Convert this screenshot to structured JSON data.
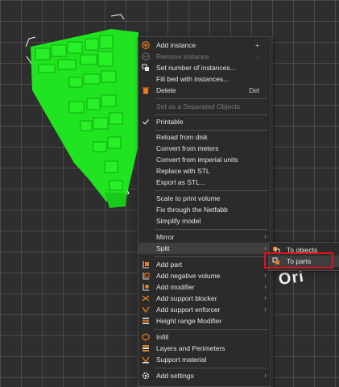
{
  "colors": {
    "model": "#1fe41f",
    "menu_bg": "#2b2b2b",
    "accent": "#e8801c",
    "callout": "#e0101a"
  },
  "bed_text": "Ori",
  "context_menu": {
    "items": [
      {
        "label": "Add instance",
        "shortcut": "+",
        "icon": "plus-circle-icon",
        "disabled": false
      },
      {
        "label": "Remove instance",
        "shortcut": "-",
        "icon": "minus-circle-icon",
        "disabled": true
      },
      {
        "label": "Set number of instances...",
        "icon": "instances-icon",
        "disabled": false
      },
      {
        "label": "Fill bed with instances...",
        "icon": "",
        "disabled": false
      },
      {
        "label": "Delete",
        "shortcut": "Del",
        "icon": "trash-icon",
        "disabled": false
      },
      {
        "label": "Set as a Separated Objects",
        "icon": "",
        "disabled": true
      },
      {
        "label": "Printable",
        "icon": "check-icon",
        "disabled": false
      },
      {
        "label": "Reload from disk",
        "icon": "",
        "disabled": false
      },
      {
        "label": "Convert from meters",
        "icon": "",
        "disabled": false
      },
      {
        "label": "Convert from imperial units",
        "icon": "",
        "disabled": false
      },
      {
        "label": "Replace with STL",
        "icon": "",
        "disabled": false
      },
      {
        "label": "Export as STL...",
        "icon": "",
        "disabled": false
      },
      {
        "label": "Scale to print volume",
        "icon": "",
        "disabled": false
      },
      {
        "label": "Fix through the Netfabb",
        "icon": "",
        "disabled": false
      },
      {
        "label": "Simplify model",
        "icon": "",
        "disabled": false
      },
      {
        "label": "Mirror",
        "icon": "",
        "submenu": true
      },
      {
        "label": "Split",
        "icon": "",
        "submenu": true,
        "active": true
      },
      {
        "label": "Add part",
        "icon": "add-part-icon",
        "submenu": true
      },
      {
        "label": "Add negative volume",
        "icon": "negative-volume-icon",
        "submenu": true
      },
      {
        "label": "Add modifier",
        "icon": "modifier-icon",
        "submenu": true
      },
      {
        "label": "Add support blocker",
        "icon": "support-blocker-icon",
        "submenu": true
      },
      {
        "label": "Add support enforcer",
        "icon": "support-enforcer-icon",
        "submenu": true
      },
      {
        "label": "Height range Modifier",
        "icon": "height-range-icon"
      },
      {
        "label": "Infill",
        "icon": "infill-icon"
      },
      {
        "label": "Layers and Perimeters",
        "icon": "layers-icon"
      },
      {
        "label": "Support material",
        "icon": "support-material-icon"
      },
      {
        "label": "Add settings",
        "icon": "gear-icon",
        "submenu": true
      }
    ]
  },
  "split_submenu": {
    "items": [
      {
        "label": "To objects",
        "icon": "split-objects-icon"
      },
      {
        "label": "To parts",
        "icon": "split-parts-icon",
        "highlighted": true
      }
    ]
  }
}
